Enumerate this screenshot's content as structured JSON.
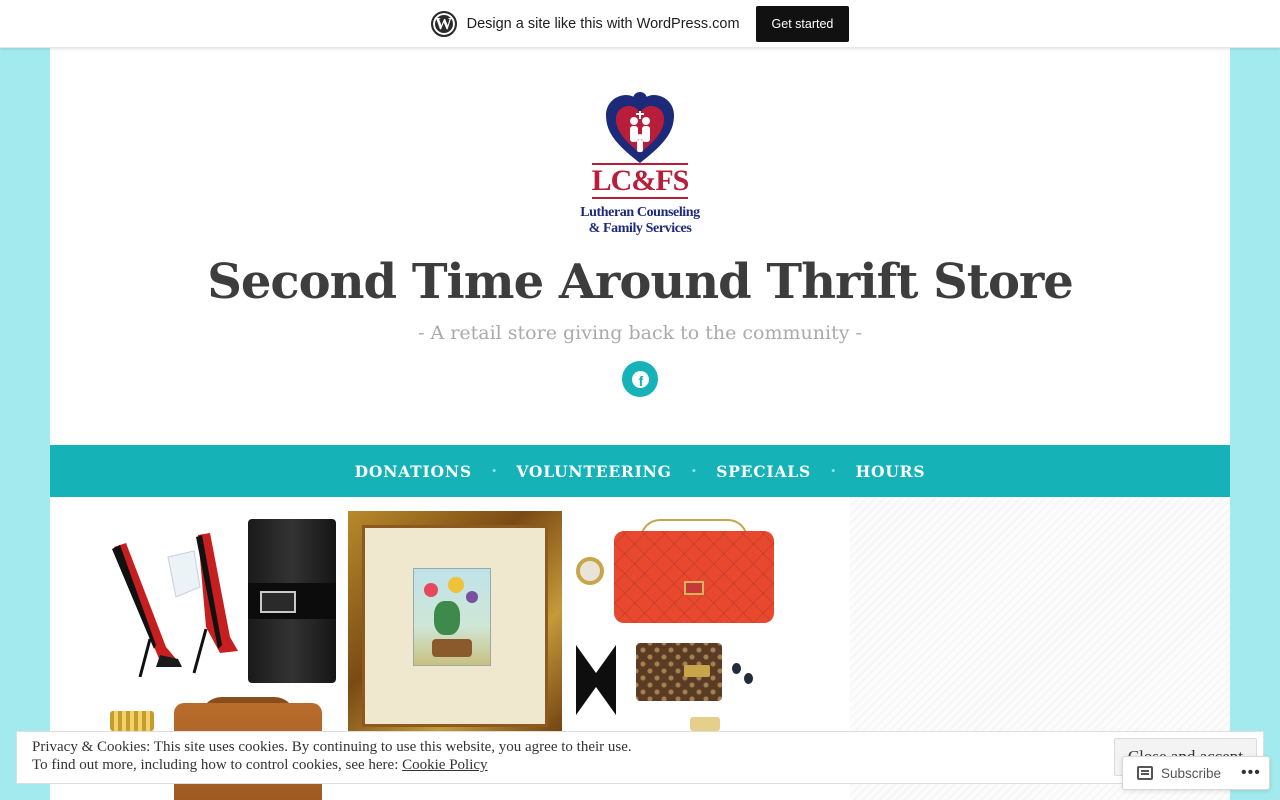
{
  "wp_banner": {
    "logo": "wordpress-icon",
    "text": "Design a site like this with WordPress.com",
    "cta_label": "Get started"
  },
  "logo": {
    "letters": "LC&FS",
    "org_line1": "Lutheran Counseling",
    "org_line2": "& Family Services",
    "colors": {
      "heart_blue": "#1d2a7a",
      "heart_red": "#b81d3a"
    }
  },
  "site": {
    "title": "Second Time Around Thrift Store",
    "tagline": "- A retail store giving back to the community -"
  },
  "social": {
    "facebook_icon": "facebook-icon",
    "facebook_glyph": "f"
  },
  "nav": {
    "items": [
      {
        "label": "DONATIONS"
      },
      {
        "label": "VOLUNTEERING"
      },
      {
        "label": "SPECIALS"
      },
      {
        "label": "HOURS"
      }
    ],
    "separator": "•"
  },
  "colors": {
    "accent": "#15b3b8",
    "page_background": "#a3eaee",
    "title_text": "#3d3d3d",
    "tagline_text": "#aaaaaa"
  },
  "cookie_banner": {
    "line1": "Privacy & Cookies: This site uses cookies. By continuing to use this website, you agree to their use.",
    "line2_prefix": "To find out more, including how to control cookies, see here: ",
    "policy_link": "Cookie Policy",
    "accept_label": "Close and accept"
  },
  "subscribe": {
    "label": "Subscribe",
    "icon": "reader-icon",
    "more": "•••"
  }
}
